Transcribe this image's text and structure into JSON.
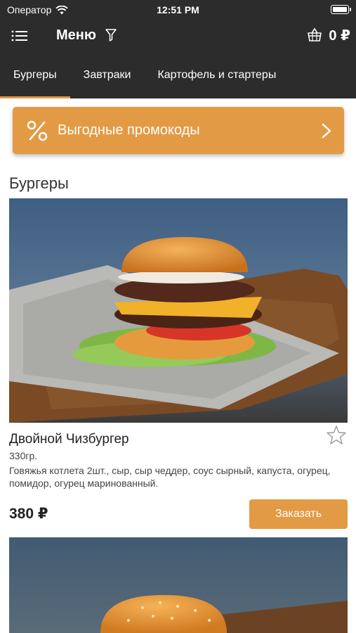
{
  "status_bar": {
    "carrier": "Оператор",
    "time": "12:51 PM",
    "battery_level": 1.0
  },
  "nav": {
    "title": "Меню",
    "cart_total": "0 ₽",
    "icons": [
      "menu-list-icon",
      "filter-icon",
      "basket-icon"
    ]
  },
  "tabs": [
    {
      "label": "Бургеры",
      "active": true
    },
    {
      "label": "Завтраки",
      "active": false
    },
    {
      "label": "Картофель и стартеры",
      "active": false
    }
  ],
  "promo": {
    "label": "Выгодные промокоды",
    "icon": "percent-icon"
  },
  "section": {
    "title": "Бургеры"
  },
  "products": [
    {
      "name": "Двойной Чизбургер",
      "weight": "330гр.",
      "description": "Говяжья котлета 2шт., сыр, сыр чеддер, соус сырный, капуста, огурец, помидор, огурец маринованный.",
      "price": "380 ₽",
      "order_label": "Заказать",
      "favorite": false
    }
  ],
  "colors": {
    "bar_bg": "#2c2c2c",
    "accent": "#e29a44",
    "text": "#222222"
  }
}
